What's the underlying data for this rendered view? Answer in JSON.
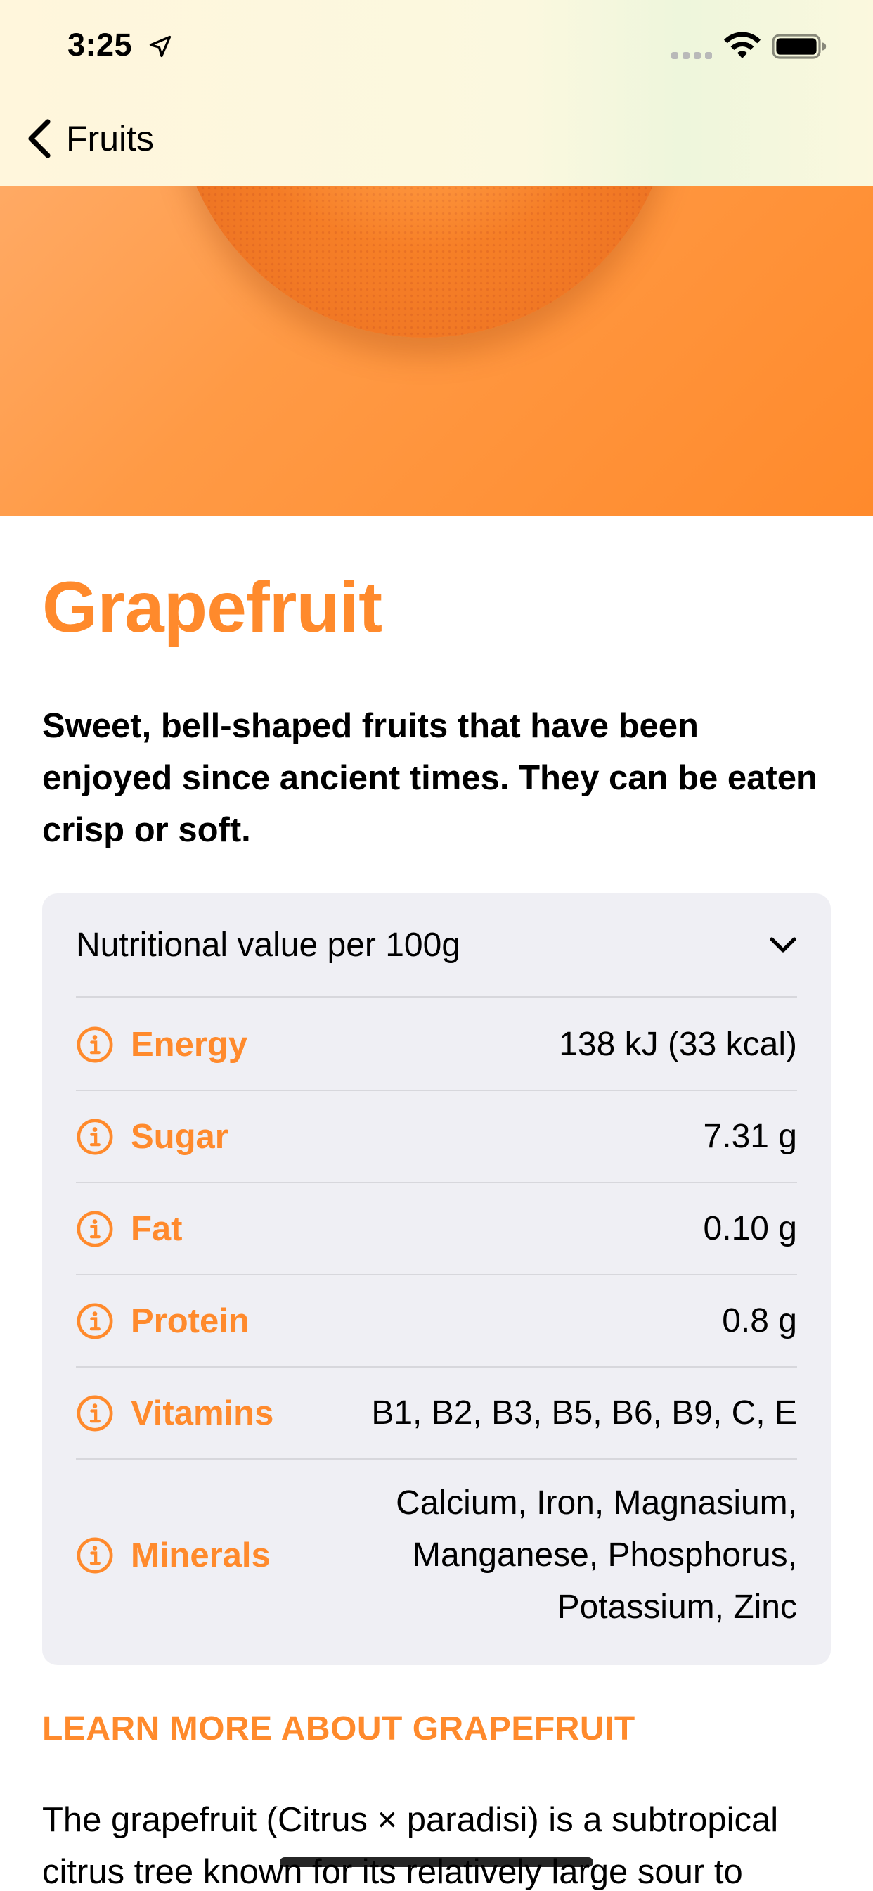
{
  "status_bar": {
    "time": "3:25",
    "icons": [
      "location-arrow-icon",
      "cellular-signal-icon",
      "wifi-icon",
      "battery-icon"
    ]
  },
  "nav": {
    "back_label": "Fruits",
    "back_icon": "chevron-left-icon"
  },
  "hero": {
    "image": "grapefruit-image",
    "background_color": "#ff9a45"
  },
  "title": "Grapefruit",
  "subtitle": "Sweet, bell-shaped fruits that have been enjoyed since ancient times. They can be eaten crisp or soft.",
  "nutrition": {
    "header": "Nutritional value per 100g",
    "rows": [
      {
        "label": "Energy",
        "value": "138 kJ (33 kcal)",
        "icon": "info-icon"
      },
      {
        "label": "Sugar",
        "value": "7.31 g",
        "icon": "info-icon"
      },
      {
        "label": "Fat",
        "value": "0.10 g",
        "icon": "info-icon"
      },
      {
        "label": "Protein",
        "value": "0.8 g",
        "icon": "info-icon"
      },
      {
        "label": "Vitamins",
        "value": "B1, B2, B3, B5, B6, B9, C, E",
        "icon": "info-icon"
      },
      {
        "label": "Minerals",
        "value": "Calcium, Iron, Magnasium, Manganese, Phosphorus, Potassium, Zinc",
        "icon": "info-icon"
      }
    ]
  },
  "learn_more_heading": "LEARN MORE ABOUT GRAPEFRUIT",
  "body_text": "The grapefruit (Citrus × paradisi) is a subtropical citrus tree known for its relatively large sour to",
  "colors": {
    "accent": "#ff8a2c",
    "card_background": "#efeff4",
    "nav_background": "#fbf8df"
  }
}
